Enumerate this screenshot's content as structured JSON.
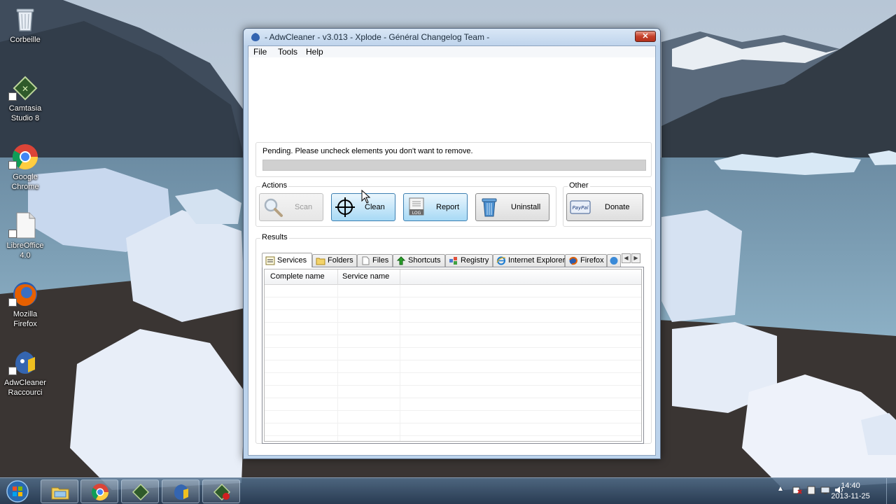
{
  "desktop": {
    "icons": [
      {
        "name": "recycle-bin-icon",
        "label": "Corbeille"
      },
      {
        "name": "camtasia-icon",
        "label": "Camtasia\nStudio 8"
      },
      {
        "name": "chrome-icon",
        "label": "Google\nChrome"
      },
      {
        "name": "libreoffice-icon",
        "label": "LibreOffice\n4.0"
      },
      {
        "name": "firefox-icon",
        "label": "Mozilla\nFirefox"
      },
      {
        "name": "adwcleaner-icon",
        "label": "AdwCleaner\nRaccourci"
      }
    ]
  },
  "window": {
    "title": "- AdwCleaner - v3.013 - Xplode - Général Changelog Team -",
    "close_label": "✕",
    "menu": [
      "File",
      "Tools",
      "Help"
    ],
    "status_text": "Pending. Please uncheck elements you don't want to remove.",
    "progress_fraction": 0,
    "actions_legend": "Actions",
    "other_legend": "Other",
    "buttons": {
      "scan": "Scan",
      "clean": "Clean",
      "report": "Report",
      "uninstall": "Uninstall",
      "donate": "Donate"
    },
    "results_legend": "Results",
    "tabs": [
      "Services",
      "Folders",
      "Files",
      "Shortcuts",
      "Registry",
      "Internet Explorer",
      "Firefox"
    ],
    "active_tab": "Services",
    "columns": [
      "Complete name",
      "Service name"
    ],
    "rows": []
  },
  "taskbar": {
    "time": "14:40",
    "date": "2013-11-25",
    "apps": [
      "explorer-icon",
      "chrome-icon",
      "camtasia-icon",
      "adwcleaner-icon",
      "recorder-icon"
    ]
  },
  "colors": {
    "accent": "#3c7fb1",
    "close": "#c4402a",
    "progress_track": "#d0d0d0"
  }
}
